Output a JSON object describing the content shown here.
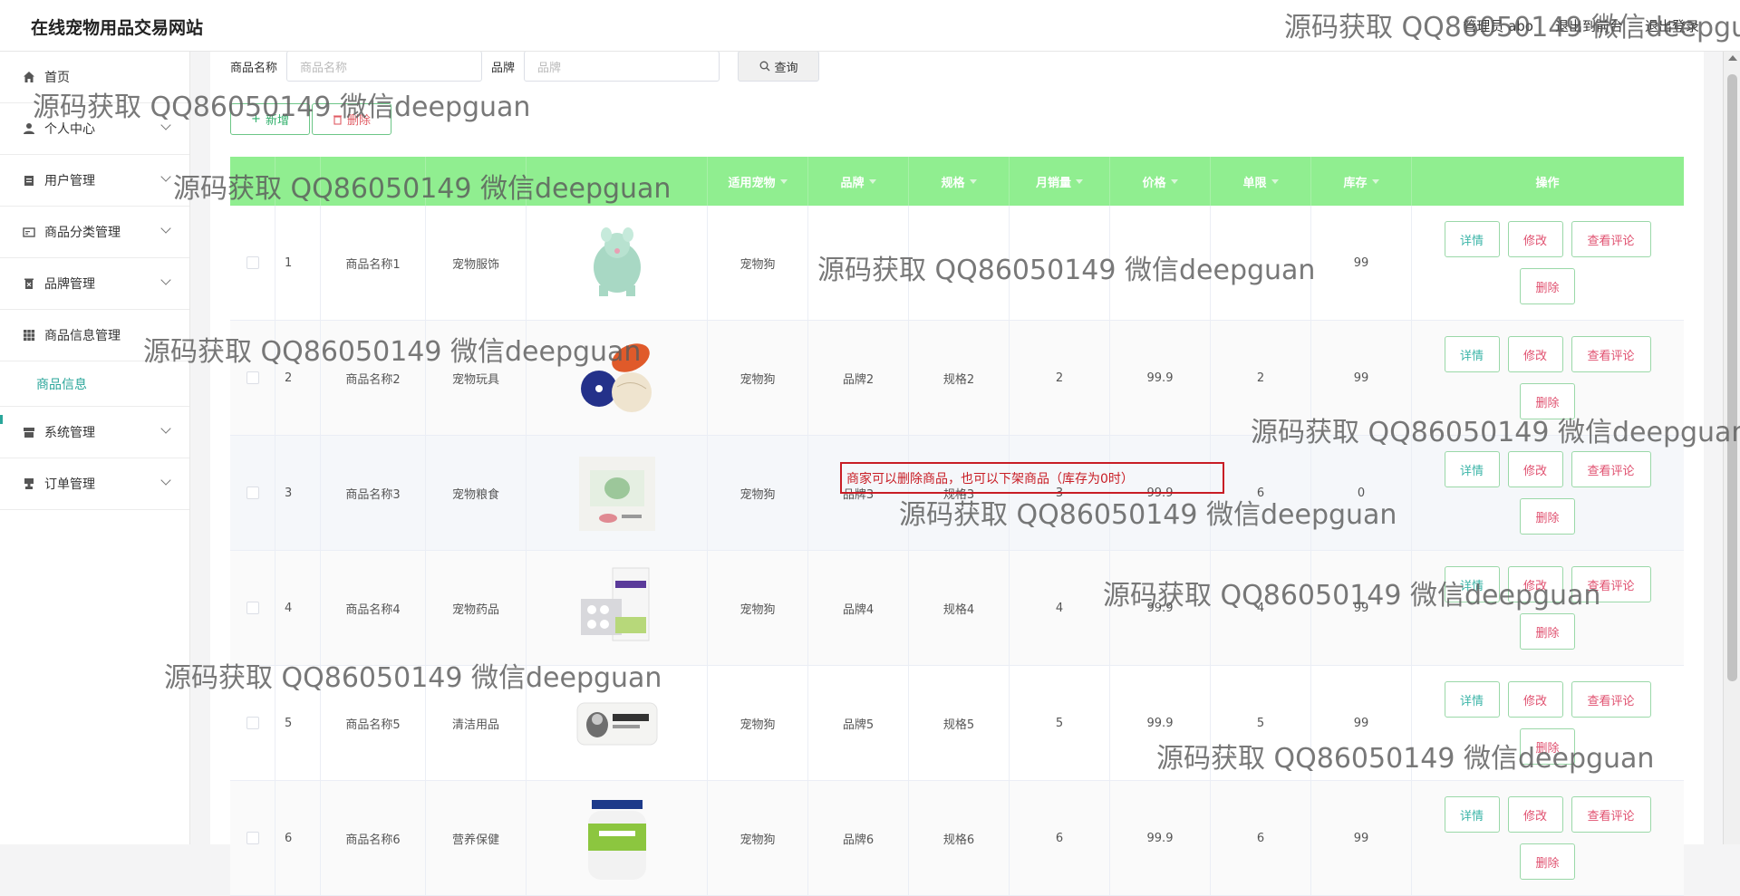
{
  "header": {
    "site_title": "在线宠物用品交易网站",
    "user_label": "管理员 abo",
    "back_label": "退出到前台",
    "logout_label": "退出登录"
  },
  "sidebar": {
    "items": [
      {
        "label": "首页",
        "icon": "home-icon"
      },
      {
        "label": "个人中心",
        "icon": "user-icon"
      },
      {
        "label": "用户管理",
        "icon": "clipboard-icon"
      },
      {
        "label": "商品分类管理",
        "icon": "card-icon"
      },
      {
        "label": "品牌管理",
        "icon": "trash-icon"
      },
      {
        "label": "商品信息管理",
        "icon": "grid-icon"
      },
      {
        "label": "商品信息",
        "icon": ""
      },
      {
        "label": "系统管理",
        "icon": "box-icon"
      },
      {
        "label": "订单管理",
        "icon": "stamp-icon"
      }
    ]
  },
  "search": {
    "name_label": "商品名称",
    "name_placeholder": "商品名称",
    "brand_label": "品牌",
    "brand_placeholder": "品牌",
    "query_label": "查询"
  },
  "actions": {
    "add_label": "新增",
    "delete_label": "删除"
  },
  "table": {
    "headers": [
      "适用宠物",
      "品牌",
      "规格",
      "月销量",
      "价格",
      "单限",
      "库存",
      "操作"
    ],
    "op_labels": {
      "detail": "详情",
      "edit": "修改",
      "review": "查看评论",
      "delete": "删除"
    },
    "rows": [
      {
        "id": "1",
        "name": "商品名称1",
        "category": "宠物服饰",
        "pet": "宠物狗",
        "brand": "",
        "spec": "",
        "sales": "",
        "price": "",
        "limit": "",
        "stock": "99"
      },
      {
        "id": "2",
        "name": "商品名称2",
        "category": "宠物玩具",
        "pet": "宠物狗",
        "brand": "品牌2",
        "spec": "规格2",
        "sales": "2",
        "price": "99.9",
        "limit": "2",
        "stock": "99"
      },
      {
        "id": "3",
        "name": "商品名称3",
        "category": "宠物粮食",
        "pet": "宠物狗",
        "brand": "品牌3",
        "spec": "规格3",
        "sales": "3",
        "price": "99.9",
        "limit": "6",
        "stock": "0"
      },
      {
        "id": "4",
        "name": "商品名称4",
        "category": "宠物药品",
        "pet": "宠物狗",
        "brand": "品牌4",
        "spec": "规格4",
        "sales": "4",
        "price": "99.9",
        "limit": "4",
        "stock": "99"
      },
      {
        "id": "5",
        "name": "商品名称5",
        "category": "清洁用品",
        "pet": "宠物狗",
        "brand": "品牌5",
        "spec": "规格5",
        "sales": "5",
        "price": "99.9",
        "limit": "5",
        "stock": "99"
      },
      {
        "id": "6",
        "name": "商品名称6",
        "category": "营养保健",
        "pet": "宠物狗",
        "brand": "品牌6",
        "spec": "规格6",
        "sales": "6",
        "price": "99.9",
        "limit": "6",
        "stock": "99"
      }
    ]
  },
  "annotation": "商家可以删除商品，也可以下架商品（库存为0时）",
  "watermark": "源码获取 QQ86050149 微信deepguan",
  "colors": {
    "header_green": "#90ee90",
    "accent": "#2aa69a",
    "annotation_red": "#c81d25"
  }
}
